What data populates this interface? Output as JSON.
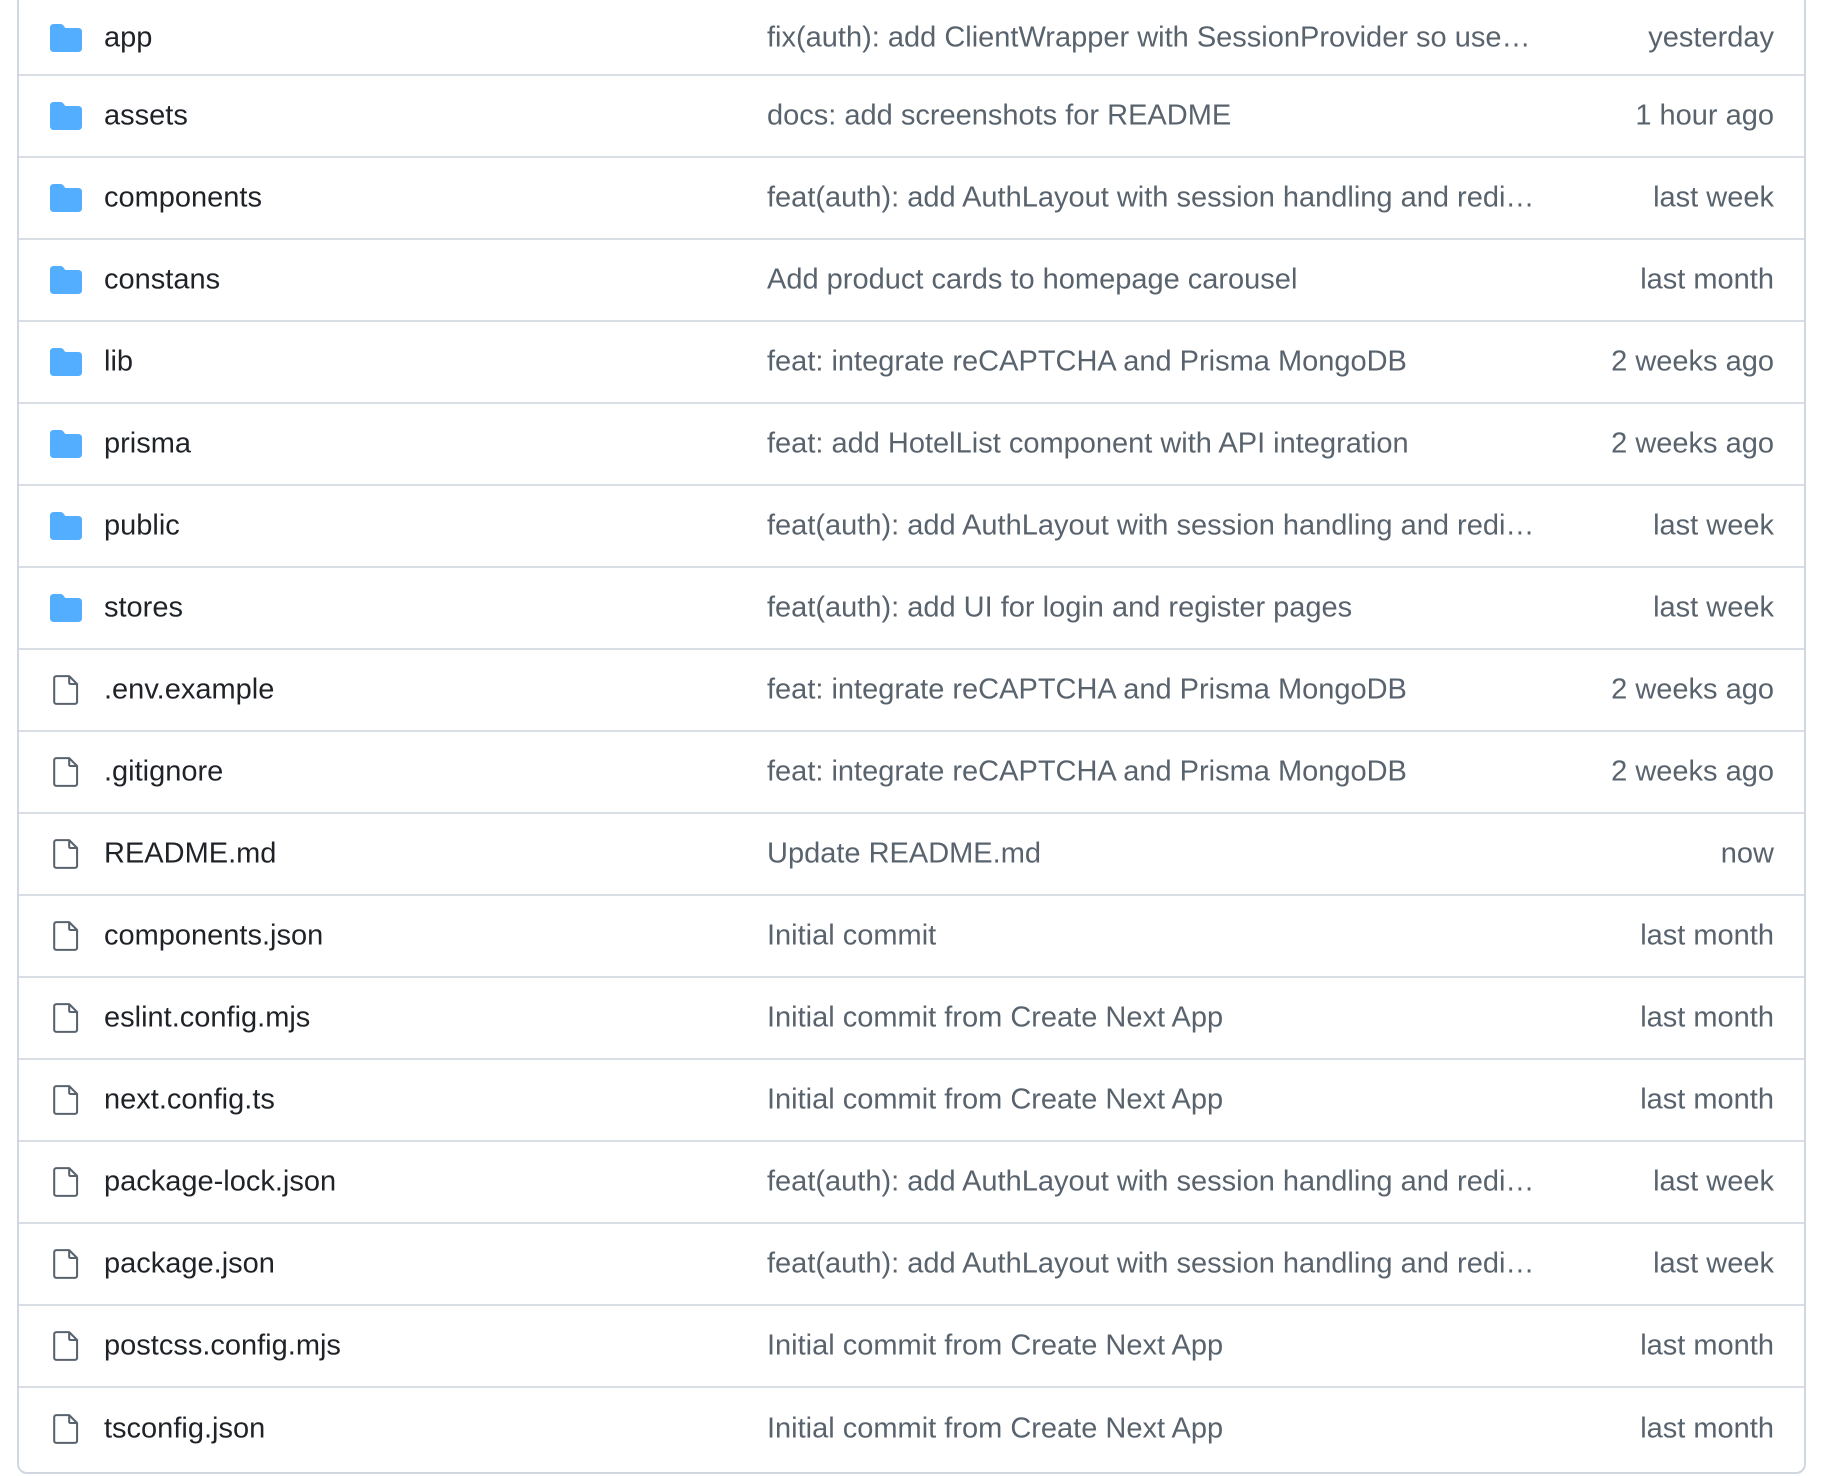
{
  "colors": {
    "folder": "#54aeff",
    "file_icon": "#59636e",
    "name_text": "#1f2328",
    "muted_text": "#59636e",
    "border": "#d0d7de"
  },
  "rows": [
    {
      "type": "folder",
      "icon": "folder-icon",
      "name": "app",
      "commit": "fix(auth): add ClientWrapper with SessionProvider so use…",
      "time": "yesterday"
    },
    {
      "type": "folder",
      "icon": "folder-icon",
      "name": "assets",
      "commit": "docs: add screenshots for README",
      "time": "1 hour ago"
    },
    {
      "type": "folder",
      "icon": "folder-icon",
      "name": "components",
      "commit": "feat(auth): add AuthLayout with session handling and redi…",
      "time": "last week"
    },
    {
      "type": "folder",
      "icon": "folder-icon",
      "name": "constans",
      "commit": "Add product cards to homepage carousel",
      "time": "last month"
    },
    {
      "type": "folder",
      "icon": "folder-icon",
      "name": "lib",
      "commit": "feat: integrate reCAPTCHA and Prisma MongoDB",
      "time": "2 weeks ago"
    },
    {
      "type": "folder",
      "icon": "folder-icon",
      "name": "prisma",
      "commit": "feat: add HotelList component with API integration",
      "time": "2 weeks ago"
    },
    {
      "type": "folder",
      "icon": "folder-icon",
      "name": "public",
      "commit": "feat(auth): add AuthLayout with session handling and redi…",
      "time": "last week"
    },
    {
      "type": "folder",
      "icon": "folder-icon",
      "name": "stores",
      "commit": "feat(auth): add UI for login and register pages",
      "time": "last week"
    },
    {
      "type": "file",
      "icon": "file-icon",
      "name": ".env.example",
      "commit": "feat: integrate reCAPTCHA and Prisma MongoDB",
      "time": "2 weeks ago"
    },
    {
      "type": "file",
      "icon": "file-icon",
      "name": ".gitignore",
      "commit": "feat: integrate reCAPTCHA and Prisma MongoDB",
      "time": "2 weeks ago"
    },
    {
      "type": "file",
      "icon": "file-icon",
      "name": "README.md",
      "commit": "Update README.md",
      "time": "now"
    },
    {
      "type": "file",
      "icon": "file-icon",
      "name": "components.json",
      "commit": "Initial commit",
      "time": "last month"
    },
    {
      "type": "file",
      "icon": "file-icon",
      "name": "eslint.config.mjs",
      "commit": "Initial commit from Create Next App",
      "time": "last month"
    },
    {
      "type": "file",
      "icon": "file-icon",
      "name": "next.config.ts",
      "commit": "Initial commit from Create Next App",
      "time": "last month"
    },
    {
      "type": "file",
      "icon": "file-icon",
      "name": "package-lock.json",
      "commit": "feat(auth): add AuthLayout with session handling and redi…",
      "time": "last week"
    },
    {
      "type": "file",
      "icon": "file-icon",
      "name": "package.json",
      "commit": "feat(auth): add AuthLayout with session handling and redi…",
      "time": "last week"
    },
    {
      "type": "file",
      "icon": "file-icon",
      "name": "postcss.config.mjs",
      "commit": "Initial commit from Create Next App",
      "time": "last month"
    },
    {
      "type": "file",
      "icon": "file-icon",
      "name": "tsconfig.json",
      "commit": "Initial commit from Create Next App",
      "time": "last month"
    }
  ]
}
